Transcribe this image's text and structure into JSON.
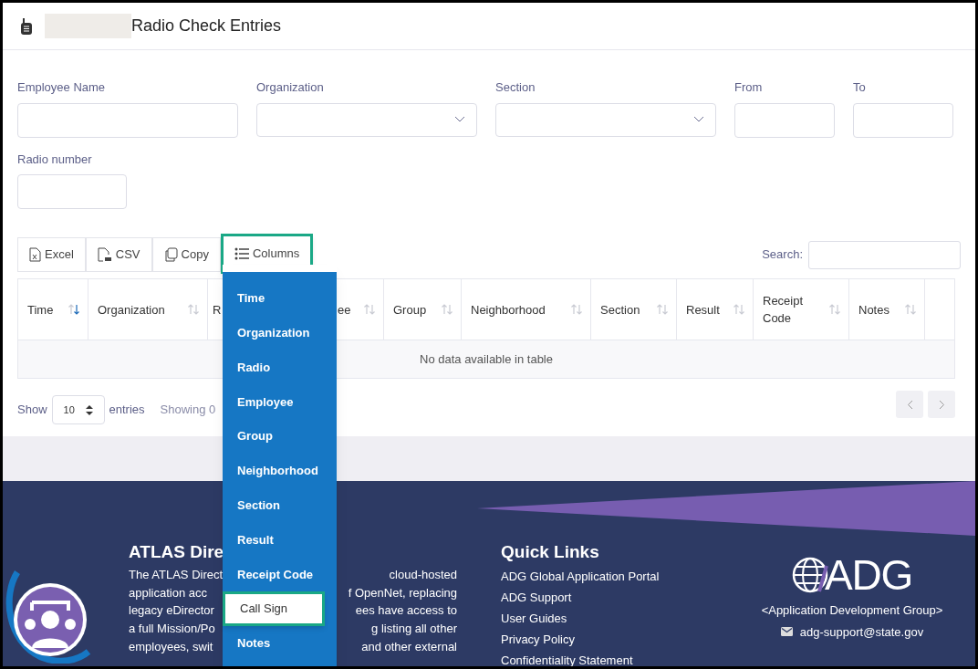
{
  "page": {
    "title": "Radio Check Entries"
  },
  "filters": [
    {
      "label": "Employee Name",
      "kind": "text"
    },
    {
      "label": "Organization",
      "kind": "select"
    },
    {
      "label": "Section",
      "kind": "select"
    },
    {
      "label": "From",
      "kind": "text"
    },
    {
      "label": "To",
      "kind": "text"
    },
    {
      "label": "Radio number",
      "kind": "text"
    }
  ],
  "toolbar": {
    "buttons": [
      {
        "label": "Excel",
        "kind": "excel",
        "highlighted": false
      },
      {
        "label": "CSV",
        "kind": "csv",
        "highlighted": false
      },
      {
        "label": "Copy",
        "kind": "copy",
        "highlighted": false
      },
      {
        "label": "Columns",
        "kind": "columns",
        "highlighted": true
      }
    ],
    "search_label": "Search:"
  },
  "table": {
    "columns": [
      {
        "label": "Time",
        "sorted": true
      },
      {
        "label": "Organization",
        "sorted": false
      },
      {
        "label": "R"
      },
      {
        "label": "ee",
        "sorted": false
      },
      {
        "label": "Group",
        "sorted": false
      },
      {
        "label": "Neighborhood",
        "sorted": false
      },
      {
        "label": "Section",
        "sorted": false
      },
      {
        "label": "Result",
        "sorted": false
      },
      {
        "label": "Receipt Code",
        "sorted": false
      },
      {
        "label": "Notes",
        "sorted": false
      }
    ],
    "empty_message": "No data available in table"
  },
  "length": {
    "show": "Show",
    "value": "10",
    "entries": "entries",
    "info": "Showing 0"
  },
  "columns_menu": [
    {
      "label": "Time",
      "selected": true,
      "highlighted": false
    },
    {
      "label": "Organization",
      "selected": true,
      "highlighted": false
    },
    {
      "label": "Radio",
      "selected": true,
      "highlighted": false
    },
    {
      "label": "Employee",
      "selected": true,
      "highlighted": false
    },
    {
      "label": "Group",
      "selected": true,
      "highlighted": false
    },
    {
      "label": "Neighborhood",
      "selected": true,
      "highlighted": false
    },
    {
      "label": "Section",
      "selected": true,
      "highlighted": false
    },
    {
      "label": "Result",
      "selected": true,
      "highlighted": false
    },
    {
      "label": "Receipt Code",
      "selected": true,
      "highlighted": false
    },
    {
      "label": "Call Sign",
      "selected": false,
      "highlighted": true
    },
    {
      "label": "Notes",
      "selected": true,
      "highlighted": false
    }
  ],
  "footer": {
    "about_title": "ATLAS Dire",
    "about_lines": [
      [
        "The ATLAS Direct",
        "cloud-hosted"
      ],
      [
        "application acc",
        "f OpenNet, replacing"
      ],
      [
        "legacy eDirector",
        "ees have access to"
      ],
      [
        "a full Mission/Po",
        "g listing all other"
      ],
      [
        "employees, swit",
        "and other external"
      ]
    ],
    "links_title": "Quick Links",
    "links": [
      "ADG Global Application Portal",
      "ADG Support",
      "User Guides",
      "Privacy Policy",
      "Confidentiality Statement"
    ],
    "brand": "ADG",
    "brand_subtitle": "<Application Development Group>",
    "email": "adg-support@state.gov"
  }
}
